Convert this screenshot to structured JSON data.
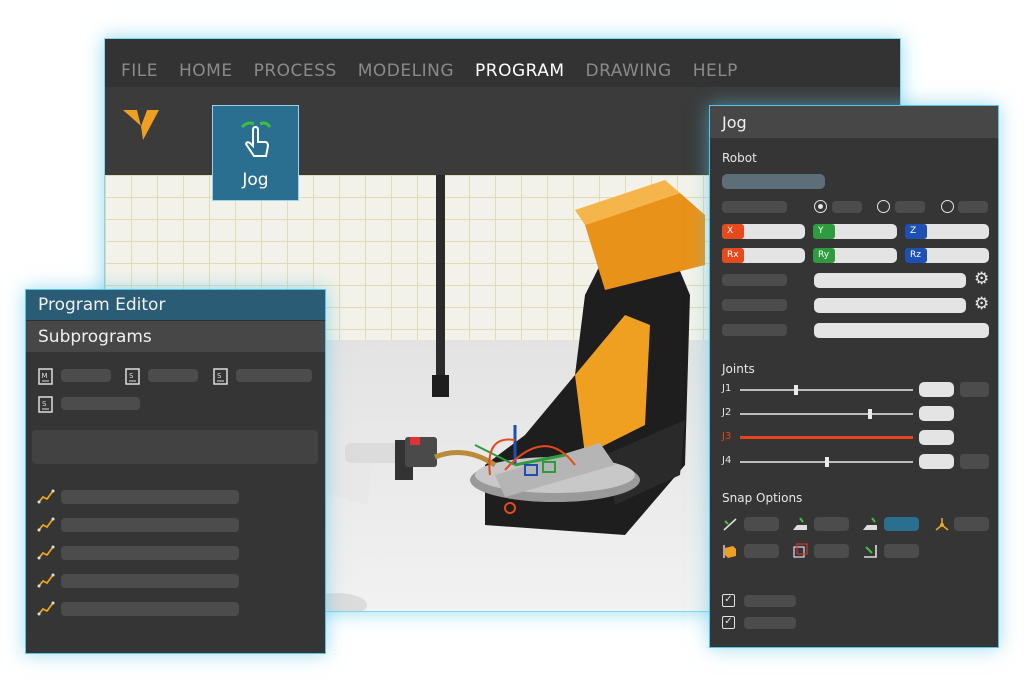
{
  "menu": {
    "items": [
      "FILE",
      "HOME",
      "PROCESS",
      "MODELING",
      "PROGRAM",
      "DRAWING",
      "HELP"
    ],
    "active": "PROGRAM"
  },
  "ribbon": {
    "jog_button_label": "Jog"
  },
  "program_editor": {
    "title": "Program Editor",
    "subtitle": "Subprograms",
    "file_icons": [
      "main-doc-icon",
      "sub-doc-icon",
      "sub-doc-icon",
      "sub-doc-icon"
    ],
    "path_icons": [
      "path-icon",
      "path-icon",
      "path-icon",
      "path-icon",
      "path-icon"
    ]
  },
  "jog_panel": {
    "title": "Jog",
    "robot_label": "Robot",
    "axes": [
      "X",
      "Y",
      "Z",
      "Rx",
      "Ry",
      "Rz"
    ],
    "joints_label": "Joints",
    "joints": [
      "J1",
      "J2",
      "J3",
      "J4"
    ],
    "joint_positions": [
      0.32,
      0.76,
      1.0,
      0.5
    ],
    "active_joint": "J3",
    "snap_label": "Snap Options",
    "gear_icon": "⚙"
  },
  "colors": {
    "accent": "#2a6f8f",
    "x_axis": "#e64a1c",
    "y_axis": "#2e9b3e",
    "z_axis": "#1d4fb5",
    "robot_orange": "#f0a020"
  }
}
